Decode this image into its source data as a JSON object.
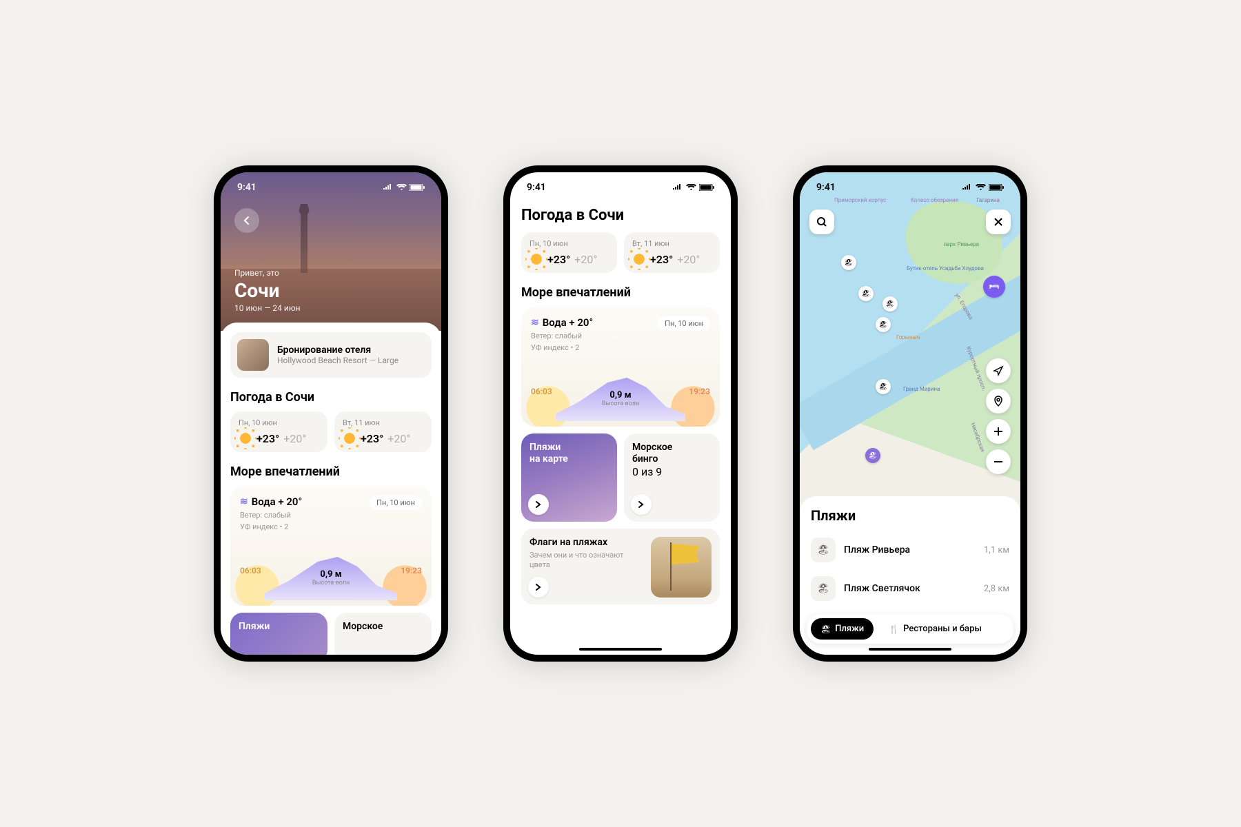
{
  "status": {
    "time": "9:41"
  },
  "phone1": {
    "hero": {
      "greeting": "Привет, это",
      "city": "Сочи",
      "dates": "10 июн — 24 июн"
    },
    "booking": {
      "title": "Бронирование отеля",
      "subtitle": "Hollywood Beach Resort — Large"
    },
    "weather_title": "Погода в Сочи",
    "weather": [
      {
        "date": "Пн, 10 июн",
        "hi": "+23°",
        "lo": "+20°"
      },
      {
        "date": "Вт, 11 июн",
        "hi": "+23°",
        "lo": "+20°"
      }
    ],
    "impressions_title": "Море впечатлений",
    "sea": {
      "water_label": "Вода + 20°",
      "day_pill": "Пн, 10 июн",
      "wind": "Ветер: слабый",
      "uv_label": "УФ индекс",
      "uv_value": "2",
      "sunrise": "06:03",
      "sunset": "19:23",
      "wave_h": "0,9 м",
      "wave_sub": "Высота волн"
    },
    "tiles": {
      "beaches_map": "Пляжи",
      "marine": "Морское"
    }
  },
  "phone2": {
    "title": "Погода в Сочи",
    "weather": [
      {
        "date": "Пн, 10 июн",
        "hi": "+23°",
        "lo": "+20°"
      },
      {
        "date": "Вт, 11 июн",
        "hi": "+23°",
        "lo": "+20°"
      }
    ],
    "impressions_title": "Море впечатлений",
    "sea": {
      "water_label": "Вода + 20°",
      "day_pill": "Пн, 10 июн",
      "wind": "Ветер: слабый",
      "uv_label": "УФ индекс",
      "uv_value": "2",
      "sunrise": "06:03",
      "sunset": "19:23",
      "wave_h": "0,9 м",
      "wave_sub": "Высота волн"
    },
    "tile_beaches_l1": "Пляжи",
    "tile_beaches_l2": "на карте",
    "tile_bingo_l1": "Морское",
    "tile_bingo_l2": "бинго",
    "tile_bingo_sub": "0 из 9",
    "flags_title": "Флаги на пляжах",
    "flags_sub": "Зачем они и что означают цвета"
  },
  "phone3": {
    "map_labels": {
      "primorskiy": "Приморский корпус",
      "koleso": "Колесо обозрения",
      "gagarina": "Гагарина",
      "riviera_park": "парк Ривьера",
      "boutique": "Бутик-отель Усадьба Хлудова",
      "egorova": "ул. Егорова",
      "gorynych": "Горыныч",
      "marina": "Гранд Марина",
      "kurortniy": "Курортный просп.",
      "nesebr": "Несебрская"
    },
    "sheet_title": "Пляжи",
    "beaches": [
      {
        "name": "Пляж Ривьера",
        "dist": "1,1 км"
      },
      {
        "name": "Пляж Светлячок",
        "dist": "2,8 км"
      }
    ],
    "chips": {
      "beaches": "Пляжи",
      "restaurants": "Рестораны и бары"
    }
  }
}
